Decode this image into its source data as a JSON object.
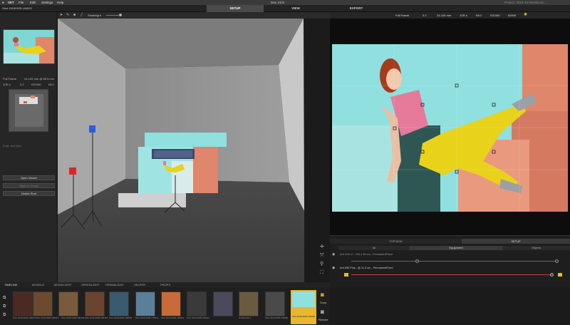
{
  "menu": {
    "apple": "",
    "app": "SET",
    "file": "File",
    "edit": "Edit",
    "settings": "Settings",
    "help": "Help",
    "title": "SAL V2.0",
    "project": "Project: 2019-10-Workbook-..."
  },
  "tabs": {
    "setup": "SETUP",
    "view": "VIEW",
    "export": "EXPORT"
  },
  "left": {
    "shot_title": "Shot 20190925-164522",
    "camera": "Full Frame",
    "lens": "24-105 mm @ 85.5 mm",
    "shutter": "1/30 s",
    "aperture": "3.2",
    "iso": "ISO160",
    "fstop": "f/8.0",
    "text_placeholder": "Enter text here.",
    "btn_open": "Open Viewer",
    "btn_apply": "Apply to Image",
    "btn_delete": "Delete Shot"
  },
  "toolbar": {
    "label": "Studiolight"
  },
  "camera_bar": {
    "format": "Full Frame",
    "sensor": "3.2",
    "lens": "24-105 mm",
    "shutter": "1/30 s",
    "aperture": "f/8.0",
    "iso": "ISO160",
    "wb": "6000K"
  },
  "right_bottom": {
    "tab_topview": "TOPVIEW",
    "tab_setup": "SETUP",
    "sub_all": "All",
    "sub_equipment": "Equipment",
    "sub_objects": "Objects",
    "light1": "Arri D1D-C - 100 x 30 cm - PermanentFixed",
    "light2": "Arri 650 Plus - @ 11.2 cm - PermanentFixed"
  },
  "timeline_tabs": [
    "TIMELINE",
    "MODELS",
    "MOODLIGHT",
    "SPEEDLIGHT",
    "PERMALIGHT",
    "HELPER",
    "PROPS"
  ],
  "thumbs": [
    {
      "label": "Shot 2019 0925-150237"
    },
    {
      "label": "Shot 2019 0925-150411"
    },
    {
      "label": "Shot 2019 0925-150439"
    },
    {
      "label": "Shot 2019 0925-150718"
    },
    {
      "label": "Shot 2019 0925-150833"
    },
    {
      "label": "Shot 2019 0925-170511"
    },
    {
      "label": "Shot 2019 0925-160014"
    },
    {
      "label": "Shot 2019 0925-160213"
    },
    {
      "label": "Untitled-file 1"
    },
    {
      "label": "Shot 2019 0925-163900"
    },
    {
      "label": "Shot 2019 0925-164522"
    }
  ],
  "side_buttons": {
    "snap": "Snap",
    "render": "Render"
  },
  "colors": {
    "accent": "#e8b630",
    "teal": "#8fe0df",
    "coral": "#e0866a",
    "yellow": "#e9d21a",
    "pink": "#e67a9a"
  }
}
